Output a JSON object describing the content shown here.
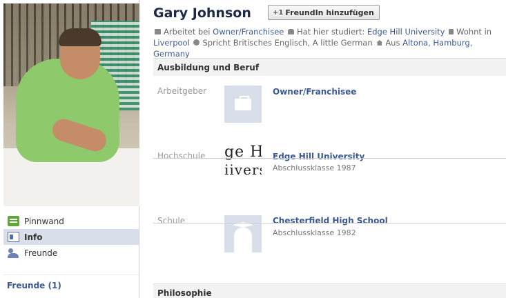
{
  "profile": {
    "name": "Gary Johnson",
    "add_friend_label": "FreundIn hinzufügen"
  },
  "infoline": {
    "work_prefix": "Arbeitet bei",
    "work_link": "Owner/Franchisee",
    "study_prefix": "Hat hier studiert:",
    "study_link": "Edge Hill University",
    "lives_prefix": "Wohnt in",
    "lives_link": "Liverpool",
    "speaks": "Spricht Britisches Englisch, A little German",
    "from_prefix": "Aus",
    "from_link1": "Altona",
    "from_link2": "Hamburg",
    "from_link3": "Germany"
  },
  "nav": {
    "items": [
      {
        "label": "Pinnwand",
        "icon": "wall-icon"
      },
      {
        "label": "Info",
        "icon": "info-icon"
      },
      {
        "label": "Freunde",
        "icon": "friends-icon"
      }
    ],
    "friends_count": "Freunde (1)"
  },
  "sections": {
    "education_work": "Ausbildung und Beruf",
    "philosophy": "Philosophie"
  },
  "entries": {
    "employer": {
      "label": "Arbeitgeber",
      "title": "Owner/Franchisee"
    },
    "university": {
      "label": "Hochschule",
      "title": "Edge Hill University",
      "sub": "Abschlussklasse 1987",
      "logo_line1": "ge H",
      "logo_line2": "iivers"
    },
    "school": {
      "label": "Schule",
      "title": "Chesterfield High School",
      "sub": "Abschlussklasse 1982"
    }
  },
  "colors": {
    "link": "#3b5998",
    "name": "#1c2a47",
    "nav_active": "#d8dfea",
    "section_bg": "#f2f2f2"
  }
}
